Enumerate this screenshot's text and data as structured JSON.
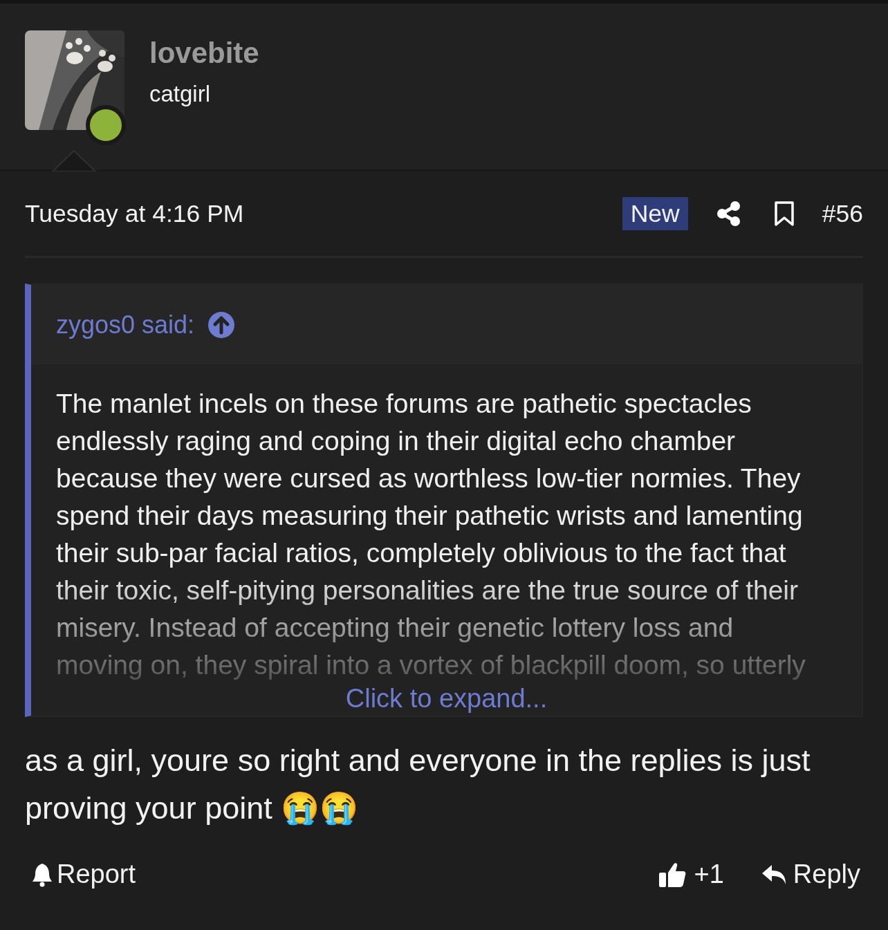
{
  "author": {
    "name": "lovebite",
    "title": "catgirl",
    "online": true
  },
  "meta": {
    "time": "Tuesday at 4:16 PM",
    "badge": "New",
    "post_number": "#56"
  },
  "quote": {
    "attribution": "zygos0 said:",
    "text": "The manlet incels on these forums are pathetic spectacles endlessly raging and coping in their digital echo chamber because they were cursed as worthless low-tier normies. They spend their days measuring their pathetic wrists and lamenting their sub-par facial ratios, completely oblivious to the fact that their toxic, self-pitying personalities are the true source of their misery. Instead of accepting their genetic lottery loss and moving on, they spiral into a vortex of blackpill doom, so utterly",
    "expand_link": "Click to expand..."
  },
  "message": {
    "text": "as a girl, youre so right and everyone in the replies is just proving your point 😭😭"
  },
  "actions": {
    "report": "Report",
    "like_count": "+1",
    "reply": "Reply"
  }
}
